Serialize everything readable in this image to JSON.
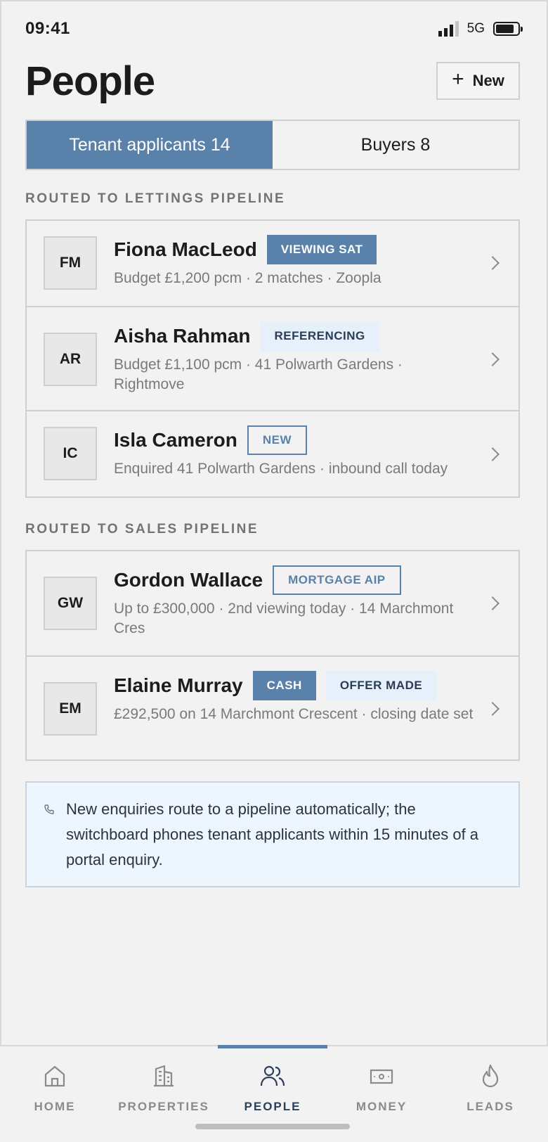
{
  "status": {
    "time": "09:41",
    "network": "5G"
  },
  "header": {
    "title": "People",
    "new_label": "New"
  },
  "segments": [
    {
      "label": "Tenant applicants 14",
      "active": true
    },
    {
      "label": "Buyers 8",
      "active": false
    }
  ],
  "lettings": {
    "label": "ROUTED TO LETTINGS PIPELINE",
    "rows": [
      {
        "initials": "FM",
        "name": "Fiona MacLeod",
        "badges": [
          {
            "text": "VIEWING SAT",
            "style": "solid"
          }
        ],
        "detail": "Budget £1,200 pcm · 2 matches · Zoopla"
      },
      {
        "initials": "AR",
        "name": "Aisha Rahman",
        "badges": [
          {
            "text": "REFERENCING",
            "style": "soft"
          }
        ],
        "detail": "Budget £1,100 pcm · 41 Polwarth Gardens · Rightmove"
      },
      {
        "initials": "IC",
        "name": "Isla Cameron",
        "badges": [
          {
            "text": "NEW",
            "style": "outline"
          }
        ],
        "detail": "Enquired 41 Polwarth Gardens · inbound call today"
      }
    ]
  },
  "sales": {
    "label": "ROUTED TO SALES PIPELINE",
    "rows": [
      {
        "initials": "GW",
        "name": "Gordon Wallace",
        "badges": [
          {
            "text": "MORTGAGE AIP",
            "style": "outline"
          }
        ],
        "detail": "Up to £300,000 · 2nd viewing today · 14 Marchmont Cres"
      },
      {
        "initials": "EM",
        "name": "Elaine Murray",
        "badges": [
          {
            "text": "CASH",
            "style": "solid"
          },
          {
            "text": "OFFER MADE",
            "style": "soft"
          }
        ],
        "detail": "£292,500 on 14 Marchmont Crescent · closing date set"
      }
    ]
  },
  "note": {
    "text": "New enquiries route to a pipeline automatically; the switchboard phones tenant applicants within 15 minutes of a portal enquiry."
  },
  "tabs": [
    {
      "label": "HOME",
      "icon": "home-icon"
    },
    {
      "label": "PROPERTIES",
      "icon": "building-icon"
    },
    {
      "label": "PEOPLE",
      "icon": "people-icon",
      "active": true
    },
    {
      "label": "MONEY",
      "icon": "banknote-icon"
    },
    {
      "label": "LEADS",
      "icon": "flame-icon"
    }
  ],
  "colors": {
    "accent": "#5a81aa",
    "soft_badge": "#e6f0fa",
    "note_bg": "#edf5fd"
  }
}
